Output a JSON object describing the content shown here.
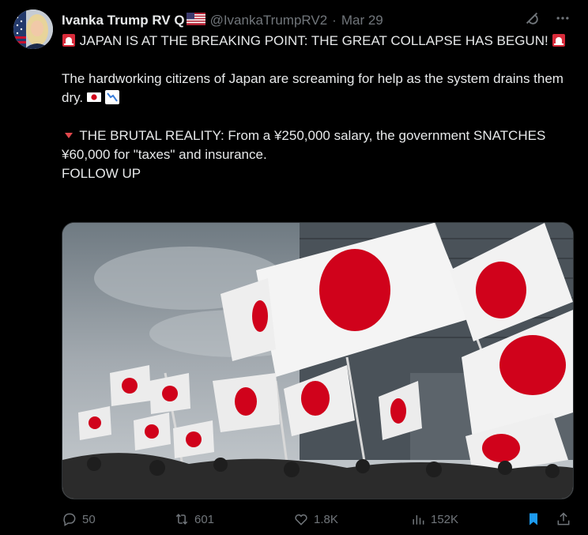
{
  "author": {
    "name": "Ivanka Trump RV Q",
    "handle": "@IvankaTrumpRV2",
    "separator": "·",
    "date": "Mar 29"
  },
  "tweet": {
    "line1": "JAPAN IS AT THE BREAKING POINT: THE GREAT COLLAPSE HAS BEGUN!",
    "line2": "The hardworking citizens of Japan are screaming for help as the system drains them dry.",
    "line3": "THE BRUTAL REALITY: From a ¥250,000 salary, the government SNATCHES ¥60,000 for \"taxes\" and insurance.",
    "line4": "FOLLOW UP"
  },
  "icons": {
    "alarm": "rotating-light-icon",
    "flag": "japan-flag-icon",
    "chart": "chart-decreasing-icon",
    "triangle": "red-triangle-down-icon",
    "us_flag": "us-flag-icon"
  },
  "actions": {
    "replies": "50",
    "reposts": "601",
    "likes": "1.8K",
    "views": "152K"
  },
  "colors": {
    "background": "#000000",
    "text": "#e7e9ea",
    "muted": "#71767b",
    "accent": "#1d9bf0",
    "flag_red": "#d0021b"
  }
}
